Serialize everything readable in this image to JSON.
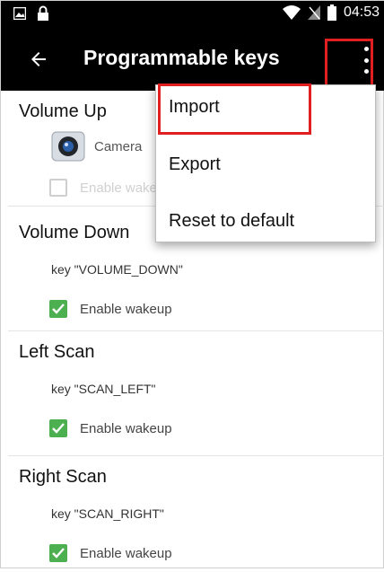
{
  "status_bar": {
    "time": "04:53"
  },
  "app_bar": {
    "title": "Programmable keys"
  },
  "groups": [
    {
      "title": "Volume Up",
      "app_name": "Camera",
      "checkbox_label": "Enable wakeup",
      "checked": false
    },
    {
      "title": "Volume Down",
      "key": "key \"VOLUME_DOWN\"",
      "checkbox_label": "Enable wakeup",
      "checked": true
    },
    {
      "title": "Left Scan",
      "key": "key \"SCAN_LEFT\"",
      "checkbox_label": "Enable wakeup",
      "checked": true
    },
    {
      "title": "Right Scan",
      "key": "key \"SCAN_RIGHT\"",
      "checkbox_label": "Enable wakeup",
      "checked": true
    }
  ],
  "menu": {
    "items": [
      "Import",
      "Export",
      "Reset to default"
    ]
  },
  "colors": {
    "accent_check": "#4caf50",
    "highlight": "#e02020",
    "bar": "#000000"
  }
}
